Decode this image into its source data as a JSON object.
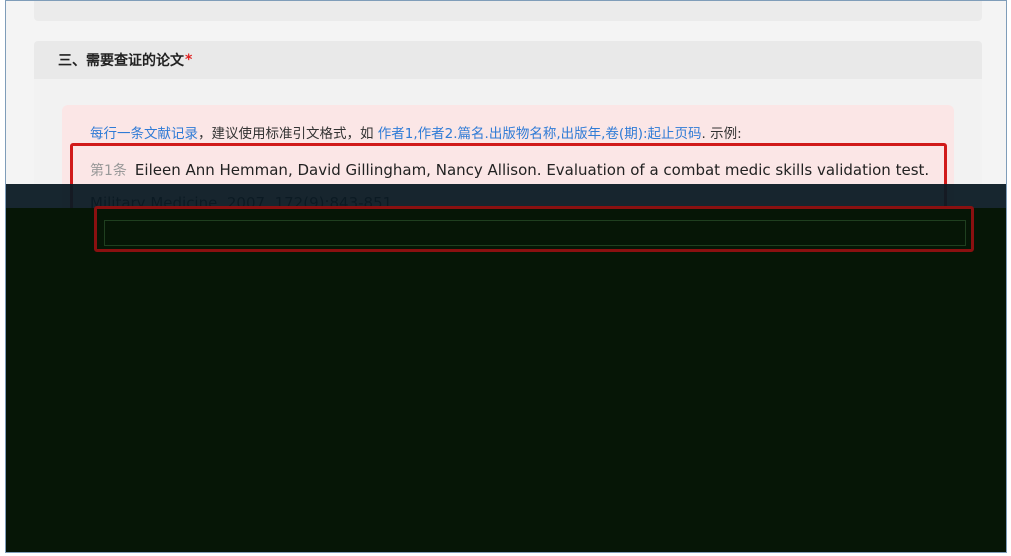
{
  "section": {
    "title": "三、需要查证的论文",
    "required_mark": "*"
  },
  "hint": {
    "part1": "每行一条文献记录",
    "part2": "，建议使用标准引文格式，如 ",
    "part3": "作者1,作者2.篇名.出版物名称,出版年,卷(期):起止页码",
    "part4": ". 示例:"
  },
  "example": {
    "prefix": "第1条",
    "text": "Eileen Ann Hemman, David Gillingham, Nancy Allison. Evaluation of a combat medic skills validation test. Military Medicine, 2007, 172(9):843-851."
  },
  "colors": {
    "accent": "#2f7bd6",
    "required": "#e02020",
    "highlight_border": "#d11a1a"
  }
}
